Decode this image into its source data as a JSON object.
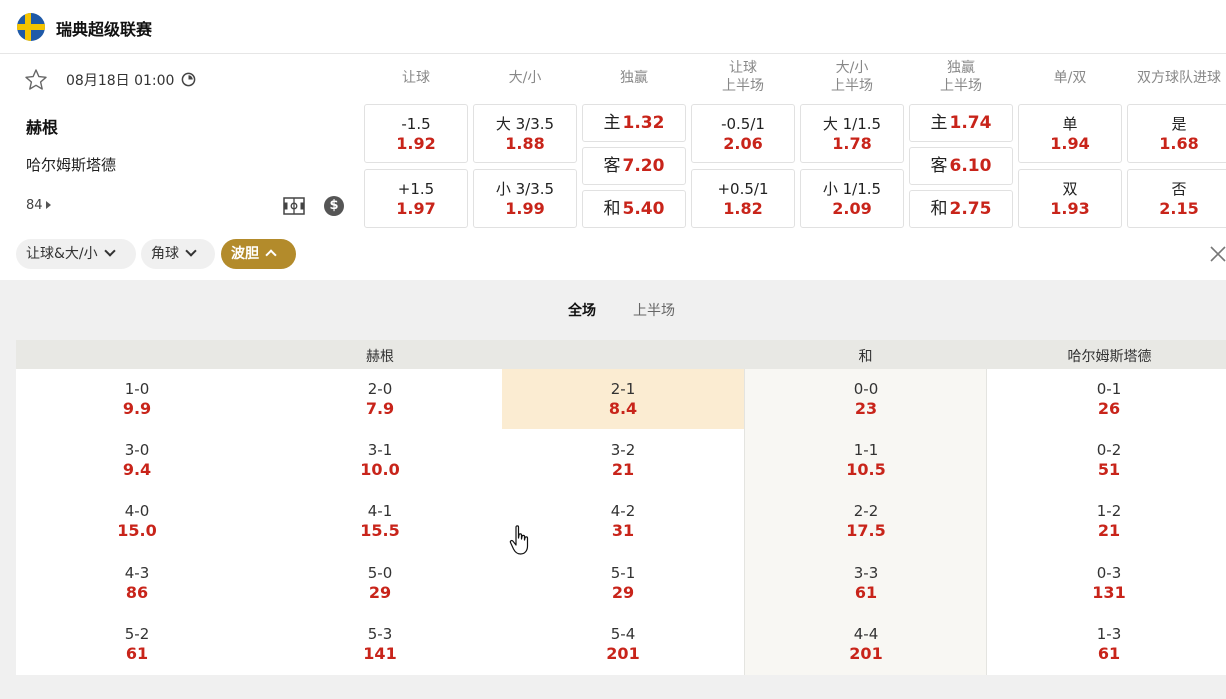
{
  "league": {
    "name": "瑞典超级联赛",
    "flag": "sweden-flag-icon"
  },
  "match": {
    "kickoff": "08月18日 01:00",
    "home": "赫根",
    "away": "哈尔姆斯塔德",
    "more_markets": "84"
  },
  "markets": [
    {
      "head": [
        "让球"
      ],
      "boxes": [
        {
          "label": "-1.5",
          "odds": "1.92"
        },
        {
          "label": "+1.5",
          "odds": "1.97"
        }
      ]
    },
    {
      "head": [
        "大/小"
      ],
      "boxes": [
        {
          "label": "大 3/3.5",
          "odds": "1.88"
        },
        {
          "label": "小 3/3.5",
          "odds": "1.99"
        }
      ]
    },
    {
      "head": [
        "独赢"
      ],
      "boxes": [
        {
          "label": "主",
          "odds": "1.32"
        },
        {
          "label": "客",
          "odds": "7.20"
        },
        {
          "label": "和",
          "odds": "5.40"
        }
      ]
    },
    {
      "head": [
        "让球",
        "上半场"
      ],
      "boxes": [
        {
          "label": "-0.5/1",
          "odds": "2.06"
        },
        {
          "label": "+0.5/1",
          "odds": "1.82"
        }
      ]
    },
    {
      "head": [
        "大/小",
        "上半场"
      ],
      "boxes": [
        {
          "label": "大 1/1.5",
          "odds": "1.78"
        },
        {
          "label": "小 1/1.5",
          "odds": "2.09"
        }
      ]
    },
    {
      "head": [
        "独赢",
        "上半场"
      ],
      "boxes": [
        {
          "label": "主",
          "odds": "1.74"
        },
        {
          "label": "客",
          "odds": "6.10"
        },
        {
          "label": "和",
          "odds": "2.75"
        }
      ]
    },
    {
      "head": [
        "单/双"
      ],
      "boxes": [
        {
          "label": "单",
          "odds": "1.94"
        },
        {
          "label": "双",
          "odds": "1.93"
        }
      ]
    },
    {
      "head": [
        "双方球队进球"
      ],
      "boxes": [
        {
          "label": "是",
          "odds": "1.68"
        },
        {
          "label": "否",
          "odds": "2.15"
        }
      ]
    }
  ],
  "filters": [
    "让球&大/小",
    "角球",
    "波胆"
  ],
  "active_filter": "波胆",
  "tabs": [
    "全场",
    "上半场"
  ],
  "active_tab": "全场",
  "correct_score": {
    "headers": {
      "home": "赫根",
      "draw": "和",
      "away": "哈尔姆斯塔德"
    },
    "highlighted": "2-1",
    "home": [
      [
        {
          "score": "1-0",
          "odds": "9.9"
        },
        {
          "score": "2-0",
          "odds": "7.9"
        },
        {
          "score": "2-1",
          "odds": "8.4"
        }
      ],
      [
        {
          "score": "3-0",
          "odds": "9.4"
        },
        {
          "score": "3-1",
          "odds": "10.0"
        },
        {
          "score": "3-2",
          "odds": "21"
        }
      ],
      [
        {
          "score": "4-0",
          "odds": "15.0"
        },
        {
          "score": "4-1",
          "odds": "15.5"
        },
        {
          "score": "4-2",
          "odds": "31"
        }
      ],
      [
        {
          "score": "4-3",
          "odds": "86"
        },
        {
          "score": "5-0",
          "odds": "29"
        },
        {
          "score": "5-1",
          "odds": "29"
        }
      ],
      [
        {
          "score": "5-2",
          "odds": "61"
        },
        {
          "score": "5-3",
          "odds": "141"
        },
        {
          "score": "5-4",
          "odds": "201"
        }
      ]
    ],
    "draw": [
      {
        "score": "0-0",
        "odds": "23"
      },
      {
        "score": "1-1",
        "odds": "10.5"
      },
      {
        "score": "2-2",
        "odds": "17.5"
      },
      {
        "score": "3-3",
        "odds": "61"
      },
      {
        "score": "4-4",
        "odds": "201"
      }
    ],
    "away": [
      {
        "score": "0-1",
        "odds": "26"
      },
      {
        "score": "0-2",
        "odds": "51"
      },
      {
        "score": "1-2",
        "odds": "21"
      },
      {
        "score": "0-3",
        "odds": "131"
      },
      {
        "score": "1-3",
        "odds": "61"
      }
    ]
  },
  "colors": {
    "odds": "#c8241a",
    "active_filter": "#b38b2b",
    "highlight": "#fbecd2"
  }
}
